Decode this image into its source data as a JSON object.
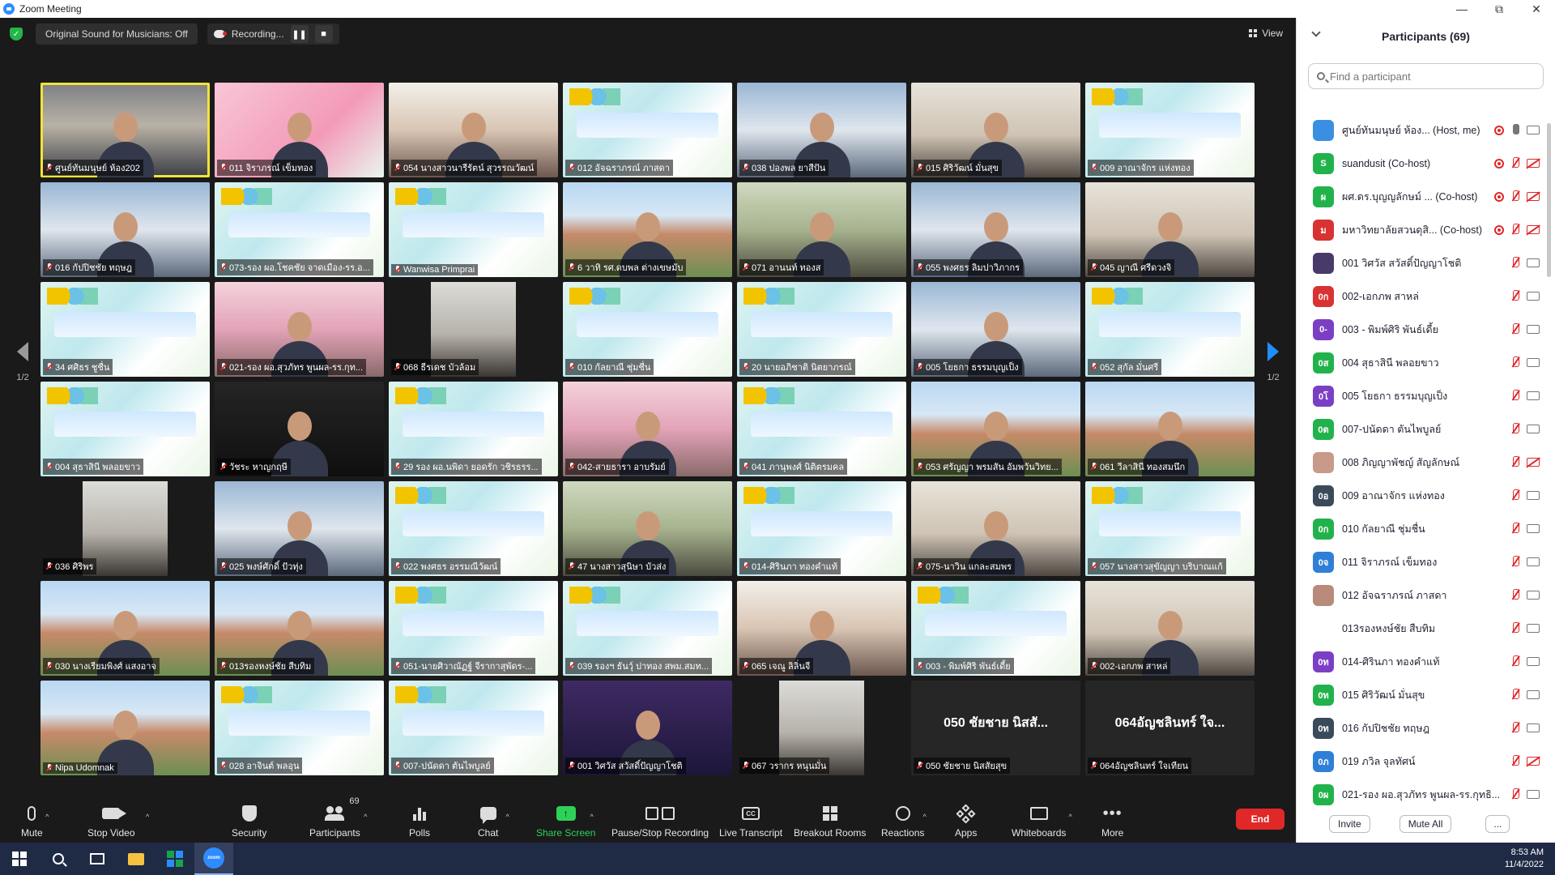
{
  "window": {
    "title": "Zoom Meeting"
  },
  "topbar": {
    "original_sound": "Original Sound for Musicians: Off",
    "recording_label": "Recording...",
    "view_label": "View"
  },
  "gallery": {
    "page_indicator_left": "1/2",
    "page_indicator_right": "1/2",
    "tiles": [
      {
        "label": "ศูนย์ทันมนุษย์ ห้อง202",
        "video": "v-room",
        "active": true,
        "pin": true
      },
      {
        "label": "011 จิราภรณ์ เข็มทอง",
        "video": "v-pink"
      },
      {
        "label": "054 นางสาวนารีรัตน์ สุวรรณวัฒน์",
        "video": "v-bright"
      },
      {
        "label": "012 อัจฉราภรณ์ ภาสดา",
        "video": "v-slide"
      },
      {
        "label": "038 ปองพล ยาสีปัน",
        "video": "v-blue"
      },
      {
        "label": "015 ศิริวัฒน์ มั่นสุข",
        "video": "v-office"
      },
      {
        "label": "009 อาณาจักร แห่งทอง",
        "video": "v-slide"
      },
      {
        "label": "016 กัปปิชชัย ทฤษฎ",
        "video": "v-blue"
      },
      {
        "label": "073-รอง ผอ.โชคชัย จาดเมือง-รร.อ...",
        "video": "v-slide"
      },
      {
        "label": "Wanwisa Primprai",
        "video": "v-slide"
      },
      {
        "label": "6 วาทิ รศ.ดบพล ต่างเขษมับ",
        "video": "v-building"
      },
      {
        "label": "071 อานนท์ ทองส",
        "video": "v-green"
      },
      {
        "label": "055 พงศธร ลิมปาวิภากร",
        "video": "v-blue"
      },
      {
        "label": "045 ญาณี ศรีดวงจิ",
        "video": "v-office"
      },
      {
        "label": "34 ศศิธร ชูชื่น",
        "video": "v-slide"
      },
      {
        "label": "021-รอง ผอ.สุวภัทร พูนผล-รร.กุท...",
        "video": "v-pinkroom"
      },
      {
        "label": "068 ธีรเดช บัวล้อม",
        "video": "v-small"
      },
      {
        "label": "010 กัลยาณี ชุ่มชื่น",
        "video": "v-slide"
      },
      {
        "label": "20 นายอภิชาติ นิตยาภรณ์",
        "video": "v-slide"
      },
      {
        "label": "005 โยธกา ธรรมบุญเป็ง",
        "video": "v-blue"
      },
      {
        "label": "052 สุกัล มั่นศรี",
        "video": "v-slide"
      },
      {
        "label": "004 สุธาสินี พลอยขาว",
        "video": "v-slide"
      },
      {
        "label": "วัชระ หาญกฤษี",
        "video": "v-dark"
      },
      {
        "label": "29 รอง ผอ.นพิดา ยอดรัก วชิรธรร...",
        "video": "v-slide"
      },
      {
        "label": "042-สายธารา อาบรัมย์",
        "video": "v-pinkroom"
      },
      {
        "label": "041 ภานุพงศ์ นิติตรมคล",
        "video": "v-slide"
      },
      {
        "label": "053 ศรัญญา พรมสัน อัมพวันวิทย...",
        "video": "v-building"
      },
      {
        "label": "061 วีลาสินี ทองสมนึก",
        "video": "v-building"
      },
      {
        "label": "036 ศิริพร",
        "video": "v-small"
      },
      {
        "label": "025 พงษ์ศักดิ์ ปัวทุ่ง",
        "video": "v-blue"
      },
      {
        "label": "022 พงศธร อรรมณีวัฒน์",
        "video": "v-slide"
      },
      {
        "label": "47 นางสาวสุนิษา บัวส่ง",
        "video": "v-green"
      },
      {
        "label": "014-ศิรินภา ทองคำแท้",
        "video": "v-slide"
      },
      {
        "label": "075-นาวิน แกละสมพร",
        "video": "v-office"
      },
      {
        "label": "057 นางสาวสุขัญญา บริบาณแก้",
        "video": "v-slide"
      },
      {
        "label": "030 นางเรียมพิงศ์ แสงอาจ",
        "video": "v-building"
      },
      {
        "label": "013รองหงษ์ชัย สืบทิม",
        "video": "v-building"
      },
      {
        "label": "051-นายศิวาณัฏฐ์ จีรากาสุพัดร-...",
        "video": "v-slide"
      },
      {
        "label": "039 รองฯ ธันวุ์ ปาทอง สพม.สมท...",
        "video": "v-slide"
      },
      {
        "label": "065 เจณู ลิลิ่นจี",
        "video": "v-bright"
      },
      {
        "label": "003 - พิมพ์ศิริ พันธ์เดี้ย",
        "video": "v-slide"
      },
      {
        "label": "002-เอกภพ สาหล่",
        "video": "v-office"
      },
      {
        "label": "Nipa Udomnak",
        "video": "v-building"
      },
      {
        "label": "028 อาจินต์ พลอุน",
        "video": "v-slide"
      },
      {
        "label": "007-ปนัดดา ตันไพบูลย์",
        "video": "v-slide"
      },
      {
        "label": "001 วิศวัส สวัสดิ์ปัญญาโชติ",
        "video": "v-purple"
      },
      {
        "label": "067 วรากร หนุนมั่น",
        "video": "v-small"
      },
      {
        "label": "050 ชัยชาย นิสสัยสุข",
        "video": "v-none",
        "bigname": "050 ชัยชาย นิสสั..."
      },
      {
        "label": "064อัญชลินทร์ ใจเทียน",
        "video": "v-none",
        "bigname": "064อัญชลินทร์ ใจ..."
      }
    ]
  },
  "toolbar": {
    "mute": "Mute",
    "stop_video": "Stop Video",
    "security": "Security",
    "participants": "Participants",
    "participants_count": "69",
    "polls": "Polls",
    "chat": "Chat",
    "share_screen": "Share Screen",
    "pause_stop_recording": "Pause/Stop Recording",
    "live_transcript": "Live Transcript",
    "cc_icon_text": "CC",
    "breakout_rooms": "Breakout Rooms",
    "reactions": "Reactions",
    "apps": "Apps",
    "whiteboards": "Whiteboards",
    "more": "More",
    "end": "End"
  },
  "participants_panel": {
    "title": "Participants (69)",
    "search_placeholder": "Find a participant",
    "invite": "Invite",
    "mute_all": "Mute All",
    "more": "...",
    "items": [
      {
        "name": "ศูนย์ทันมนุษย์ ห้อง... (Host, me)",
        "avatar": "",
        "color": "#3a8fe0",
        "rec": true,
        "mic": "on",
        "cam": "on"
      },
      {
        "name": "suandusit (Co-host)",
        "avatar": "S",
        "color": "#22b24c",
        "rec": true,
        "mic": "off",
        "cam": "off"
      },
      {
        "name": "ผศ.ดร.บุญญลักษม์ ... (Co-host)",
        "avatar": "ผ",
        "color": "#22b24c",
        "rec": true,
        "mic": "off",
        "cam": "off"
      },
      {
        "name": "มหาวิทยาลัยสวนดุสิ... (Co-host)",
        "avatar": "ม",
        "color": "#d93232",
        "rec": true,
        "mic": "off",
        "cam": "off"
      },
      {
        "name": "001 วิศวัส สวัสดิ์ปัญญาโชติ",
        "avatar": "",
        "color": "#4a3a6a",
        "mic": "off",
        "cam": "on"
      },
      {
        "name": "002-เอกภพ สาหล่",
        "avatar": "0ก",
        "color": "#d93232",
        "mic": "off",
        "cam": "on"
      },
      {
        "name": "003 - พิมพ์ศิริ พันธ์เดี้ย",
        "avatar": "0-",
        "color": "#7b3fc4",
        "mic": "off",
        "cam": "on"
      },
      {
        "name": "004 สุธาสินี พลอยขาว",
        "avatar": "0ส",
        "color": "#22b24c",
        "mic": "off",
        "cam": "on"
      },
      {
        "name": "005 โยธกา ธรรมบุญเป็ง",
        "avatar": "0โ",
        "color": "#7b3fc4",
        "mic": "off",
        "cam": "on"
      },
      {
        "name": "007-ปนัดดา ตันไพบูลย์",
        "avatar": "0ต",
        "color": "#22b24c",
        "mic": "off",
        "cam": "on"
      },
      {
        "name": "008 ภิญญาพัชญ์ สัญลักษณ์",
        "avatar": "",
        "color": "#c79a8a",
        "mic": "off",
        "cam": "off"
      },
      {
        "name": "009 อาณาจักร แห่งทอง",
        "avatar": "0อ",
        "color": "#3a4a5a",
        "mic": "off",
        "cam": "on"
      },
      {
        "name": "010 กัลยาณี ชุ่มชื่น",
        "avatar": "0ก",
        "color": "#22b24c",
        "mic": "off",
        "cam": "on"
      },
      {
        "name": "011 จิราภรณ์ เข็มทอง",
        "avatar": "0จ",
        "color": "#2f7fd6",
        "mic": "off",
        "cam": "on"
      },
      {
        "name": "012 อัจฉราภรณ์ ภาสดา",
        "avatar": "",
        "color": "#b88a7a",
        "mic": "off",
        "cam": "on"
      },
      {
        "name": "013รองหงษ์ชัย สืบทิม",
        "avatar": "",
        "color": "#ffffff",
        "mic": "off",
        "cam": "on"
      },
      {
        "name": "014-ศิรินภา ทองคำแท้",
        "avatar": "0ท",
        "color": "#7b3fc4",
        "mic": "off",
        "cam": "on"
      },
      {
        "name": "015 ศิริวัฒน์ มั่นสุข",
        "avatar": "0ท",
        "color": "#22b24c",
        "mic": "off",
        "cam": "on"
      },
      {
        "name": "016 กัปปิชชัย ทฤษฎ",
        "avatar": "0ท",
        "color": "#3a4a5a",
        "mic": "off",
        "cam": "on"
      },
      {
        "name": "019 ภวิล จุลทัศน์",
        "avatar": "0ภ",
        "color": "#2f7fd6",
        "mic": "off",
        "cam": "off"
      },
      {
        "name": "021-รอง ผอ.สุวภัทร พูนผล-รร.กุทธิ...",
        "avatar": "0ผ",
        "color": "#22b24c",
        "mic": "off",
        "cam": "on"
      }
    ]
  },
  "taskbar": {
    "time": "8:53 AM",
    "date": "11/4/2022",
    "zoom_text": "zoom"
  },
  "colors": {
    "accent": "#2d8cff",
    "end": "#e02828",
    "share": "#2ed158",
    "active_speaker": "#f0e33a"
  }
}
